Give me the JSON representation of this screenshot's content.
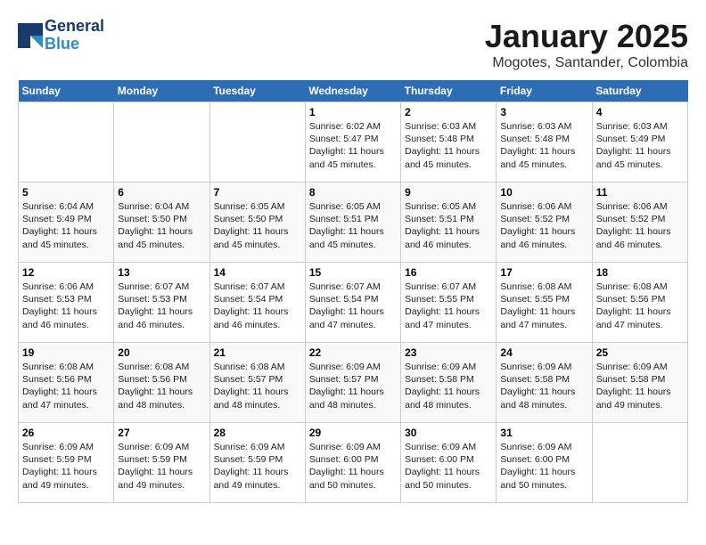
{
  "header": {
    "logo_line1": "General",
    "logo_line2": "Blue",
    "main_title": "January 2025",
    "subtitle": "Mogotes, Santander, Colombia"
  },
  "days_of_week": [
    "Sunday",
    "Monday",
    "Tuesday",
    "Wednesday",
    "Thursday",
    "Friday",
    "Saturday"
  ],
  "weeks": [
    [
      {
        "day": "",
        "info": ""
      },
      {
        "day": "",
        "info": ""
      },
      {
        "day": "",
        "info": ""
      },
      {
        "day": "1",
        "info": "Sunrise: 6:02 AM\nSunset: 5:47 PM\nDaylight: 11 hours and 45 minutes."
      },
      {
        "day": "2",
        "info": "Sunrise: 6:03 AM\nSunset: 5:48 PM\nDaylight: 11 hours and 45 minutes."
      },
      {
        "day": "3",
        "info": "Sunrise: 6:03 AM\nSunset: 5:48 PM\nDaylight: 11 hours and 45 minutes."
      },
      {
        "day": "4",
        "info": "Sunrise: 6:03 AM\nSunset: 5:49 PM\nDaylight: 11 hours and 45 minutes."
      }
    ],
    [
      {
        "day": "5",
        "info": "Sunrise: 6:04 AM\nSunset: 5:49 PM\nDaylight: 11 hours and 45 minutes."
      },
      {
        "day": "6",
        "info": "Sunrise: 6:04 AM\nSunset: 5:50 PM\nDaylight: 11 hours and 45 minutes."
      },
      {
        "day": "7",
        "info": "Sunrise: 6:05 AM\nSunset: 5:50 PM\nDaylight: 11 hours and 45 minutes."
      },
      {
        "day": "8",
        "info": "Sunrise: 6:05 AM\nSunset: 5:51 PM\nDaylight: 11 hours and 45 minutes."
      },
      {
        "day": "9",
        "info": "Sunrise: 6:05 AM\nSunset: 5:51 PM\nDaylight: 11 hours and 46 minutes."
      },
      {
        "day": "10",
        "info": "Sunrise: 6:06 AM\nSunset: 5:52 PM\nDaylight: 11 hours and 46 minutes."
      },
      {
        "day": "11",
        "info": "Sunrise: 6:06 AM\nSunset: 5:52 PM\nDaylight: 11 hours and 46 minutes."
      }
    ],
    [
      {
        "day": "12",
        "info": "Sunrise: 6:06 AM\nSunset: 5:53 PM\nDaylight: 11 hours and 46 minutes."
      },
      {
        "day": "13",
        "info": "Sunrise: 6:07 AM\nSunset: 5:53 PM\nDaylight: 11 hours and 46 minutes."
      },
      {
        "day": "14",
        "info": "Sunrise: 6:07 AM\nSunset: 5:54 PM\nDaylight: 11 hours and 46 minutes."
      },
      {
        "day": "15",
        "info": "Sunrise: 6:07 AM\nSunset: 5:54 PM\nDaylight: 11 hours and 47 minutes."
      },
      {
        "day": "16",
        "info": "Sunrise: 6:07 AM\nSunset: 5:55 PM\nDaylight: 11 hours and 47 minutes."
      },
      {
        "day": "17",
        "info": "Sunrise: 6:08 AM\nSunset: 5:55 PM\nDaylight: 11 hours and 47 minutes."
      },
      {
        "day": "18",
        "info": "Sunrise: 6:08 AM\nSunset: 5:56 PM\nDaylight: 11 hours and 47 minutes."
      }
    ],
    [
      {
        "day": "19",
        "info": "Sunrise: 6:08 AM\nSunset: 5:56 PM\nDaylight: 11 hours and 47 minutes."
      },
      {
        "day": "20",
        "info": "Sunrise: 6:08 AM\nSunset: 5:56 PM\nDaylight: 11 hours and 48 minutes."
      },
      {
        "day": "21",
        "info": "Sunrise: 6:08 AM\nSunset: 5:57 PM\nDaylight: 11 hours and 48 minutes."
      },
      {
        "day": "22",
        "info": "Sunrise: 6:09 AM\nSunset: 5:57 PM\nDaylight: 11 hours and 48 minutes."
      },
      {
        "day": "23",
        "info": "Sunrise: 6:09 AM\nSunset: 5:58 PM\nDaylight: 11 hours and 48 minutes."
      },
      {
        "day": "24",
        "info": "Sunrise: 6:09 AM\nSunset: 5:58 PM\nDaylight: 11 hours and 48 minutes."
      },
      {
        "day": "25",
        "info": "Sunrise: 6:09 AM\nSunset: 5:58 PM\nDaylight: 11 hours and 49 minutes."
      }
    ],
    [
      {
        "day": "26",
        "info": "Sunrise: 6:09 AM\nSunset: 5:59 PM\nDaylight: 11 hours and 49 minutes."
      },
      {
        "day": "27",
        "info": "Sunrise: 6:09 AM\nSunset: 5:59 PM\nDaylight: 11 hours and 49 minutes."
      },
      {
        "day": "28",
        "info": "Sunrise: 6:09 AM\nSunset: 5:59 PM\nDaylight: 11 hours and 49 minutes."
      },
      {
        "day": "29",
        "info": "Sunrise: 6:09 AM\nSunset: 6:00 PM\nDaylight: 11 hours and 50 minutes."
      },
      {
        "day": "30",
        "info": "Sunrise: 6:09 AM\nSunset: 6:00 PM\nDaylight: 11 hours and 50 minutes."
      },
      {
        "day": "31",
        "info": "Sunrise: 6:09 AM\nSunset: 6:00 PM\nDaylight: 11 hours and 50 minutes."
      },
      {
        "day": "",
        "info": ""
      }
    ]
  ]
}
